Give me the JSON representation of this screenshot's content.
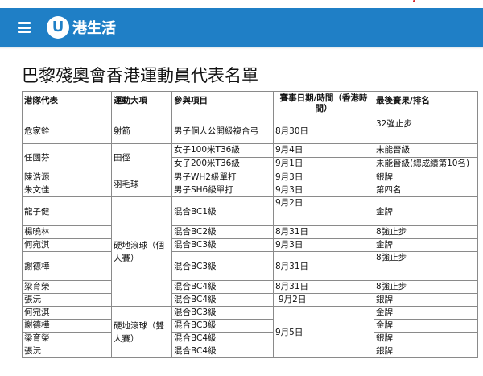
{
  "header": {
    "logo_mark": "U",
    "logo_text": "港生活"
  },
  "title": "巴黎殘奧會香港運動員代表名單",
  "columns": {
    "athlete": "港隊代表",
    "sport": "運動大項",
    "event": "參與項目",
    "date": "賽事日期/時間（香港時間）",
    "result": "最後賽果/排名"
  },
  "rows": {
    "r1": {
      "athlete": "危家銓",
      "sport": "射箭",
      "event": "男子個人公開級複合弓",
      "date": "8月30日",
      "result": "32強止步"
    },
    "r2": {
      "athlete": "任國芬",
      "sport": "田徑",
      "event": "女子100米T36級",
      "date": "9月4日",
      "result": "未能晉級"
    },
    "r3": {
      "event": "女子200米T36級",
      "date": "9月1日",
      "result": "未能晉級(總成績第10名)"
    },
    "r4": {
      "athlete": "陳浩源",
      "sport": "羽毛球",
      "event": "男子WH2級單打",
      "date": "9月3日",
      "result": "銀牌"
    },
    "r5": {
      "athlete": "朱文佳",
      "event": "男子SH6級單打",
      "date": "9月3日",
      "result": "第四名"
    },
    "r6": {
      "athlete": "龍子健",
      "sport": "硬地滾球（個人賽）",
      "event": "混合BC1級",
      "date": "9月2日",
      "result": "金牌"
    },
    "r7": {
      "athlete": "楊曉林",
      "event": "混合BC2級",
      "date": "8月31日",
      "result": "8強止步"
    },
    "r8": {
      "athlete": "何宛淇",
      "event": "混合BC3級",
      "date": "9月3日",
      "result": "金牌"
    },
    "r9": {
      "athlete": "謝德樺",
      "event": "混合BC3級",
      "date": "8月31日",
      "result": "8強止步"
    },
    "r10": {
      "athlete": "梁育榮",
      "event": "混合BC4級",
      "date": "8月31日",
      "result": "8強止步"
    },
    "r11": {
      "athlete": "張沅",
      "event": "混合BC4級",
      "date": "9月2日",
      "result": "銀牌"
    },
    "r12": {
      "athlete": "何宛淇",
      "sport": "硬地滾球（雙人賽）",
      "event": "混合BC3級",
      "date": "9月5日",
      "result": "金牌"
    },
    "r13": {
      "athlete": "謝德樺",
      "event": "混合BC3級",
      "result": "金牌"
    },
    "r14": {
      "athlete": "梁育榮",
      "event": "混合BC4級",
      "result": "銀牌"
    },
    "r15": {
      "athlete": "張沅",
      "event": "混合BC4級",
      "result": "銀牌"
    }
  }
}
